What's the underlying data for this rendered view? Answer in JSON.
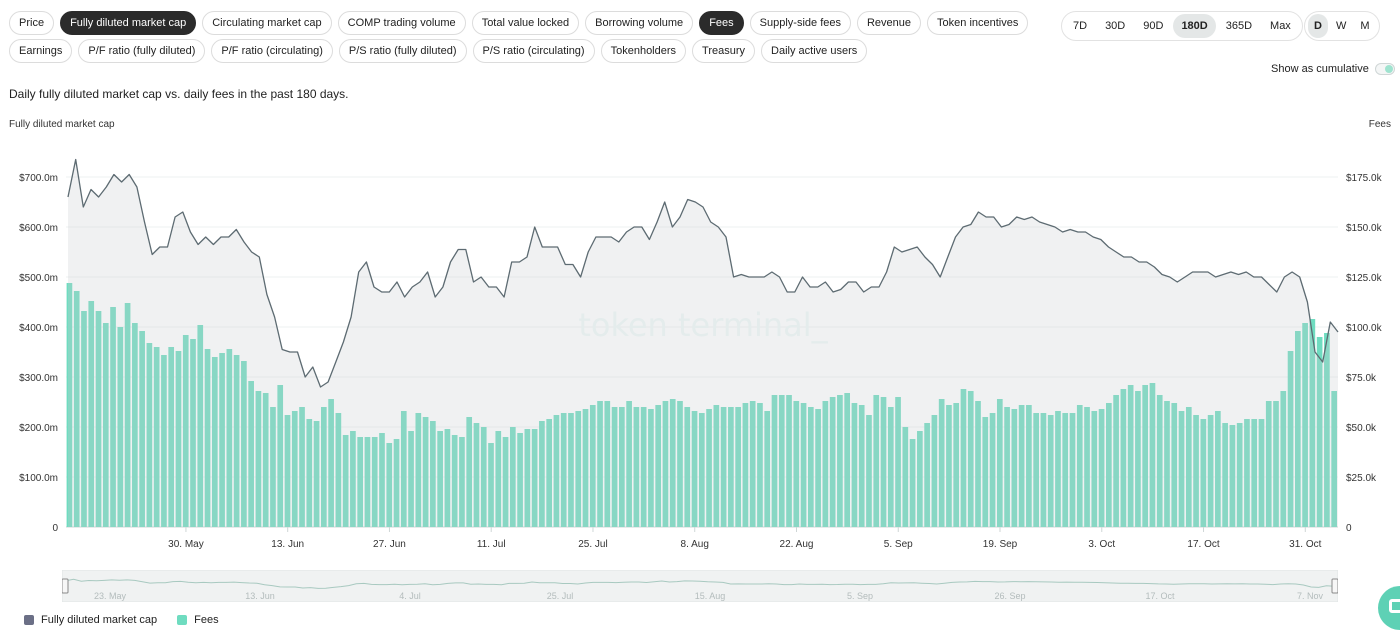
{
  "metric_tabs_row1": [
    {
      "label": "Price",
      "active": false
    },
    {
      "label": "Fully diluted market cap",
      "active": true
    },
    {
      "label": "Circulating market cap",
      "active": false
    },
    {
      "label": "COMP trading volume",
      "active": false
    },
    {
      "label": "Total value locked",
      "active": false
    },
    {
      "label": "Borrowing volume",
      "active": false
    },
    {
      "label": "Fees",
      "active": true
    },
    {
      "label": "Supply-side fees",
      "active": false
    },
    {
      "label": "Revenue",
      "active": false
    },
    {
      "label": "Token incentives",
      "active": false
    }
  ],
  "metric_tabs_row2": [
    {
      "label": "Earnings",
      "active": false
    },
    {
      "label": "P/F ratio (fully diluted)",
      "active": false
    },
    {
      "label": "P/F ratio (circulating)",
      "active": false
    },
    {
      "label": "P/S ratio (fully diluted)",
      "active": false
    },
    {
      "label": "P/S ratio (circulating)",
      "active": false
    },
    {
      "label": "Tokenholders",
      "active": false
    },
    {
      "label": "Treasury",
      "active": false
    },
    {
      "label": "Daily active users",
      "active": false
    }
  ],
  "time_ranges": [
    {
      "label": "7D",
      "active": false
    },
    {
      "label": "30D",
      "active": false
    },
    {
      "label": "90D",
      "active": false
    },
    {
      "label": "180D",
      "active": true
    },
    {
      "label": "365D",
      "active": false
    },
    {
      "label": "Max",
      "active": false
    }
  ],
  "granularity": [
    {
      "label": "D",
      "active": true
    },
    {
      "label": "W",
      "active": false
    },
    {
      "label": "M",
      "active": false
    }
  ],
  "cumulative_label": "Show as cumulative",
  "subtitle": "Daily fully diluted market cap vs. daily fees in the past 180 days.",
  "left_axis_title": "Fully diluted market cap",
  "right_axis_title": "Fees",
  "watermark": "token terminal_",
  "navigator_labels": [
    "23. May",
    "13. Jun",
    "4. Jul",
    "25. Jul",
    "15. Aug",
    "5. Sep",
    "26. Sep",
    "17. Oct",
    "7. Nov"
  ],
  "legend": [
    {
      "name": "Fully diluted market cap",
      "color": "#6b6f86"
    },
    {
      "name": "Fees",
      "color": "#6fdcc0"
    }
  ],
  "chart_data": {
    "type": "bar+line",
    "x_start": "2022-05-14",
    "x_end": "2022-11-09",
    "x_tick_labels": [
      "30. May",
      "13. Jun",
      "27. Jun",
      "11. Jul",
      "25. Jul",
      "8. Aug",
      "22. Aug",
      "5. Sep",
      "19. Sep",
      "3. Oct",
      "17. Oct",
      "31. Oct"
    ],
    "y_left": {
      "label": "Fully diluted market cap",
      "ticks": [
        "0",
        "$100.0m",
        "$200.0m",
        "$300.0m",
        "$400.0m",
        "$500.0m",
        "$600.0m",
        "$700.0m"
      ],
      "min": 0,
      "max": 750,
      "unit": "$m"
    },
    "y_right": {
      "label": "Fees",
      "ticks": [
        "0",
        "$25.0k",
        "$50.0k",
        "$75.0k",
        "$100.0k",
        "$125.0k",
        "$150.0k",
        "$175.0k"
      ],
      "min": 0,
      "max": 187.5,
      "unit": "$k"
    },
    "series": [
      {
        "name": "Fully diluted market cap",
        "kind": "line",
        "axis": "left",
        "color": "#5d6b72",
        "values": [
          660,
          735,
          640,
          675,
          660,
          680,
          705,
          690,
          705,
          680,
          610,
          545,
          560,
          560,
          620,
          630,
          590,
          565,
          580,
          565,
          580,
          580,
          595,
          570,
          550,
          540,
          465,
          420,
          355,
          350,
          350,
          300,
          320,
          280,
          290,
          330,
          370,
          420,
          510,
          530,
          480,
          470,
          470,
          490,
          460,
          480,
          490,
          510,
          460,
          480,
          530,
          555,
          555,
          490,
          500,
          480,
          480,
          460,
          530,
          530,
          540,
          600,
          560,
          560,
          560,
          525,
          525,
          500,
          550,
          580,
          580,
          580,
          570,
          590,
          600,
          600,
          575,
          610,
          650,
          600,
          620,
          655,
          650,
          640,
          610,
          600,
          580,
          500,
          505,
          500,
          500,
          500,
          510,
          500,
          470,
          470,
          500,
          480,
          480,
          490,
          470,
          475,
          490,
          490,
          470,
          480,
          480,
          510,
          560,
          550,
          555,
          560,
          540,
          525,
          500,
          540,
          580,
          600,
          605,
          630,
          620,
          620,
          600,
          605,
          620,
          615,
          620,
          610,
          605,
          600,
          590,
          595,
          590,
          590,
          580,
          575,
          560,
          550,
          540,
          540,
          530,
          530,
          520,
          505,
          500,
          490,
          500,
          510,
          510,
          510,
          500,
          505,
          510,
          505,
          510,
          500,
          500,
          485,
          470,
          500,
          510,
          500,
          450,
          350,
          330,
          410,
          390
        ]
      },
      {
        "name": "Fees",
        "kind": "bar",
        "axis": "right",
        "color": "#6fdcc0",
        "values": [
          122,
          118,
          108,
          113,
          108,
          102,
          110,
          100,
          112,
          102,
          98,
          92,
          90,
          86,
          90,
          88,
          96,
          94,
          101,
          89,
          85,
          87,
          89,
          86,
          83,
          73,
          68,
          67,
          60,
          71,
          56,
          58,
          60,
          54,
          53,
          60,
          64,
          57,
          46,
          48,
          45,
          45,
          45,
          47,
          42,
          44,
          58,
          48,
          57,
          55,
          53,
          48,
          49,
          46,
          45,
          55,
          52,
          50,
          42,
          48,
          45,
          50,
          47,
          49,
          49,
          53,
          54,
          56,
          57,
          57,
          58,
          59,
          61,
          63,
          63,
          60,
          60,
          63,
          60,
          60,
          59,
          61,
          63,
          64,
          63,
          60,
          58,
          57,
          59,
          61,
          60,
          60,
          60,
          62,
          63,
          62,
          58,
          66,
          66,
          66,
          63,
          62,
          60,
          59,
          63,
          65,
          66,
          67,
          62,
          61,
          56,
          66,
          65,
          60,
          65,
          50,
          44,
          48,
          52,
          56,
          64,
          61,
          62,
          69,
          68,
          63,
          55,
          57,
          64,
          60,
          59,
          61,
          61,
          57,
          57,
          56,
          58,
          57,
          57,
          61,
          60,
          58,
          59,
          62,
          66,
          69,
          71,
          68,
          71,
          72,
          66,
          63,
          62,
          58,
          60,
          56,
          54,
          56,
          58,
          52,
          51,
          52,
          54,
          54,
          54,
          63,
          63,
          68,
          88,
          98,
          102,
          104,
          95,
          97,
          68
        ]
      }
    ]
  }
}
